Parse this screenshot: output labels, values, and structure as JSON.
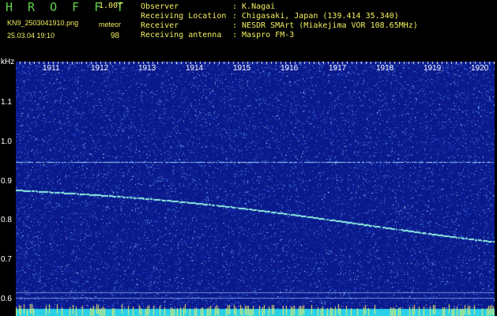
{
  "header": {
    "app_title": "H R O F F T",
    "version": "1.00f",
    "filename": "KN9_2503041910.png",
    "mode": "meteor",
    "datetime": "25.03.04 19:10",
    "count": "98",
    "info": [
      {
        "label": "Observer",
        "value": ": K.Nagai"
      },
      {
        "label": "Receiving Location",
        "value": ": Chigasaki, Japan (139.414 35.340)"
      },
      {
        "label": "Receiver",
        "value": ": NESDR SMArt (Miakejima VOR 108.65MHz)"
      },
      {
        "label": "Receiving antenna",
        "value": ": Maspro FM-3"
      }
    ]
  },
  "axis": {
    "y_unit": "kHz",
    "y_ticks": [
      "1.1",
      "1.0",
      "0.9",
      "0.8",
      "0.7",
      "0.6"
    ],
    "time_labels": [
      "1911",
      "1912",
      "1913",
      "1914",
      "1915",
      "1916",
      "1917",
      "1918",
      "1919",
      "1920"
    ]
  },
  "colors": {
    "background": "#000000",
    "spectrogram_base": "#0a1a8c",
    "noise_light": "#5fa0ff",
    "trace": "#8ff0e0",
    "header_green": "#5fd24a",
    "header_yellow": "#f2f060",
    "bottom_band": "#2ad0e8",
    "bottom_spikes": "#f2f060"
  }
}
